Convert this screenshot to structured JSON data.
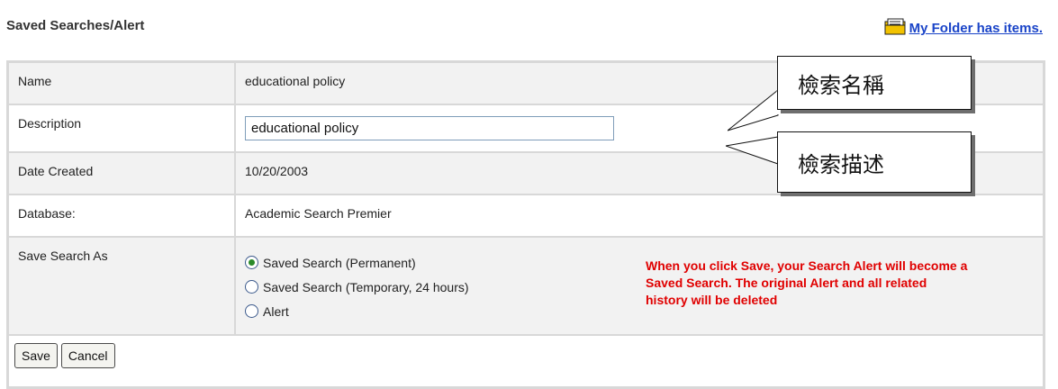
{
  "header": {
    "title": "Saved Searches/Alert",
    "folder_link": "My Folder has items."
  },
  "form": {
    "rows": [
      {
        "label": "Name",
        "value": "educational policy"
      },
      {
        "label": "Description",
        "value": "educational policy"
      },
      {
        "label": "Date Created",
        "value": "10/20/2003"
      },
      {
        "label": "Database:",
        "value": "Academic Search Premier"
      },
      {
        "label": "Save Search As"
      }
    ],
    "save_options": [
      {
        "label": "Saved Search (Permanent)",
        "checked": true
      },
      {
        "label": "Saved Search (Temporary, 24 hours)",
        "checked": false
      },
      {
        "label": "Alert",
        "checked": false
      }
    ],
    "warning": "When you click Save, your Search Alert will become a Saved Search. The original Alert and all related history will be deleted",
    "buttons": {
      "save": "Save",
      "cancel": "Cancel"
    }
  },
  "callouts": {
    "name": "檢索名稱",
    "description": "檢索描述"
  },
  "colors": {
    "link": "#1a44c8",
    "warning": "#e00000",
    "row_shade": "#f2f2f2",
    "border": "#d8d8d8"
  },
  "icons": {
    "folder": "folder-icon",
    "radio_checked": "radio-checked-icon",
    "radio_unchecked": "radio-unchecked-icon"
  }
}
